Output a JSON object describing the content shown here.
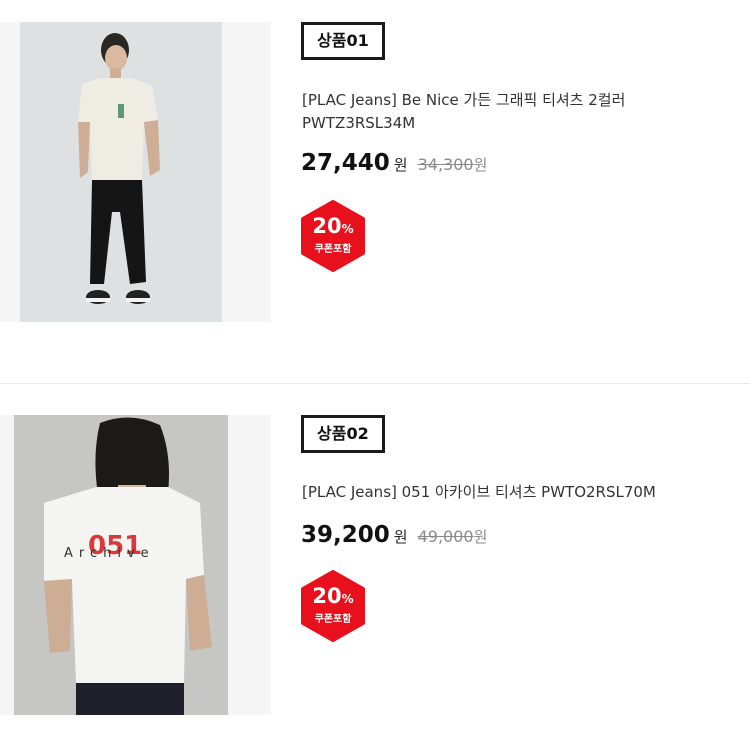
{
  "products": [
    {
      "badge": "상품01",
      "name": "[PLAC Jeans]  Be Nice 가든 그래픽 티셔츠 2컬러 PWTZ3RSL34M",
      "price": "27,440",
      "won": "원",
      "original_price": "34,300",
      "original_won": "원",
      "discount_percent": "20",
      "percent_sign": "%",
      "coupon_label": "쿠폰포함",
      "image_icon": "model-tshirt-photo"
    },
    {
      "badge": "상품02",
      "name": "[PLAC Jeans]  051 아카이브 티셔츠 PWTO2RSL70M",
      "price": "39,200",
      "won": "원",
      "original_price": "49,000",
      "original_won": "원",
      "discount_percent": "20",
      "percent_sign": "%",
      "coupon_label": "쿠폰포함",
      "image_icon": "model-back-tshirt-photo",
      "image_print": {
        "top": "051",
        "word": "Archive"
      }
    }
  ],
  "colors": {
    "coupon_red": "#e8101c",
    "badge_border": "#1a1a1a",
    "original_price": "#8a8a8a"
  }
}
